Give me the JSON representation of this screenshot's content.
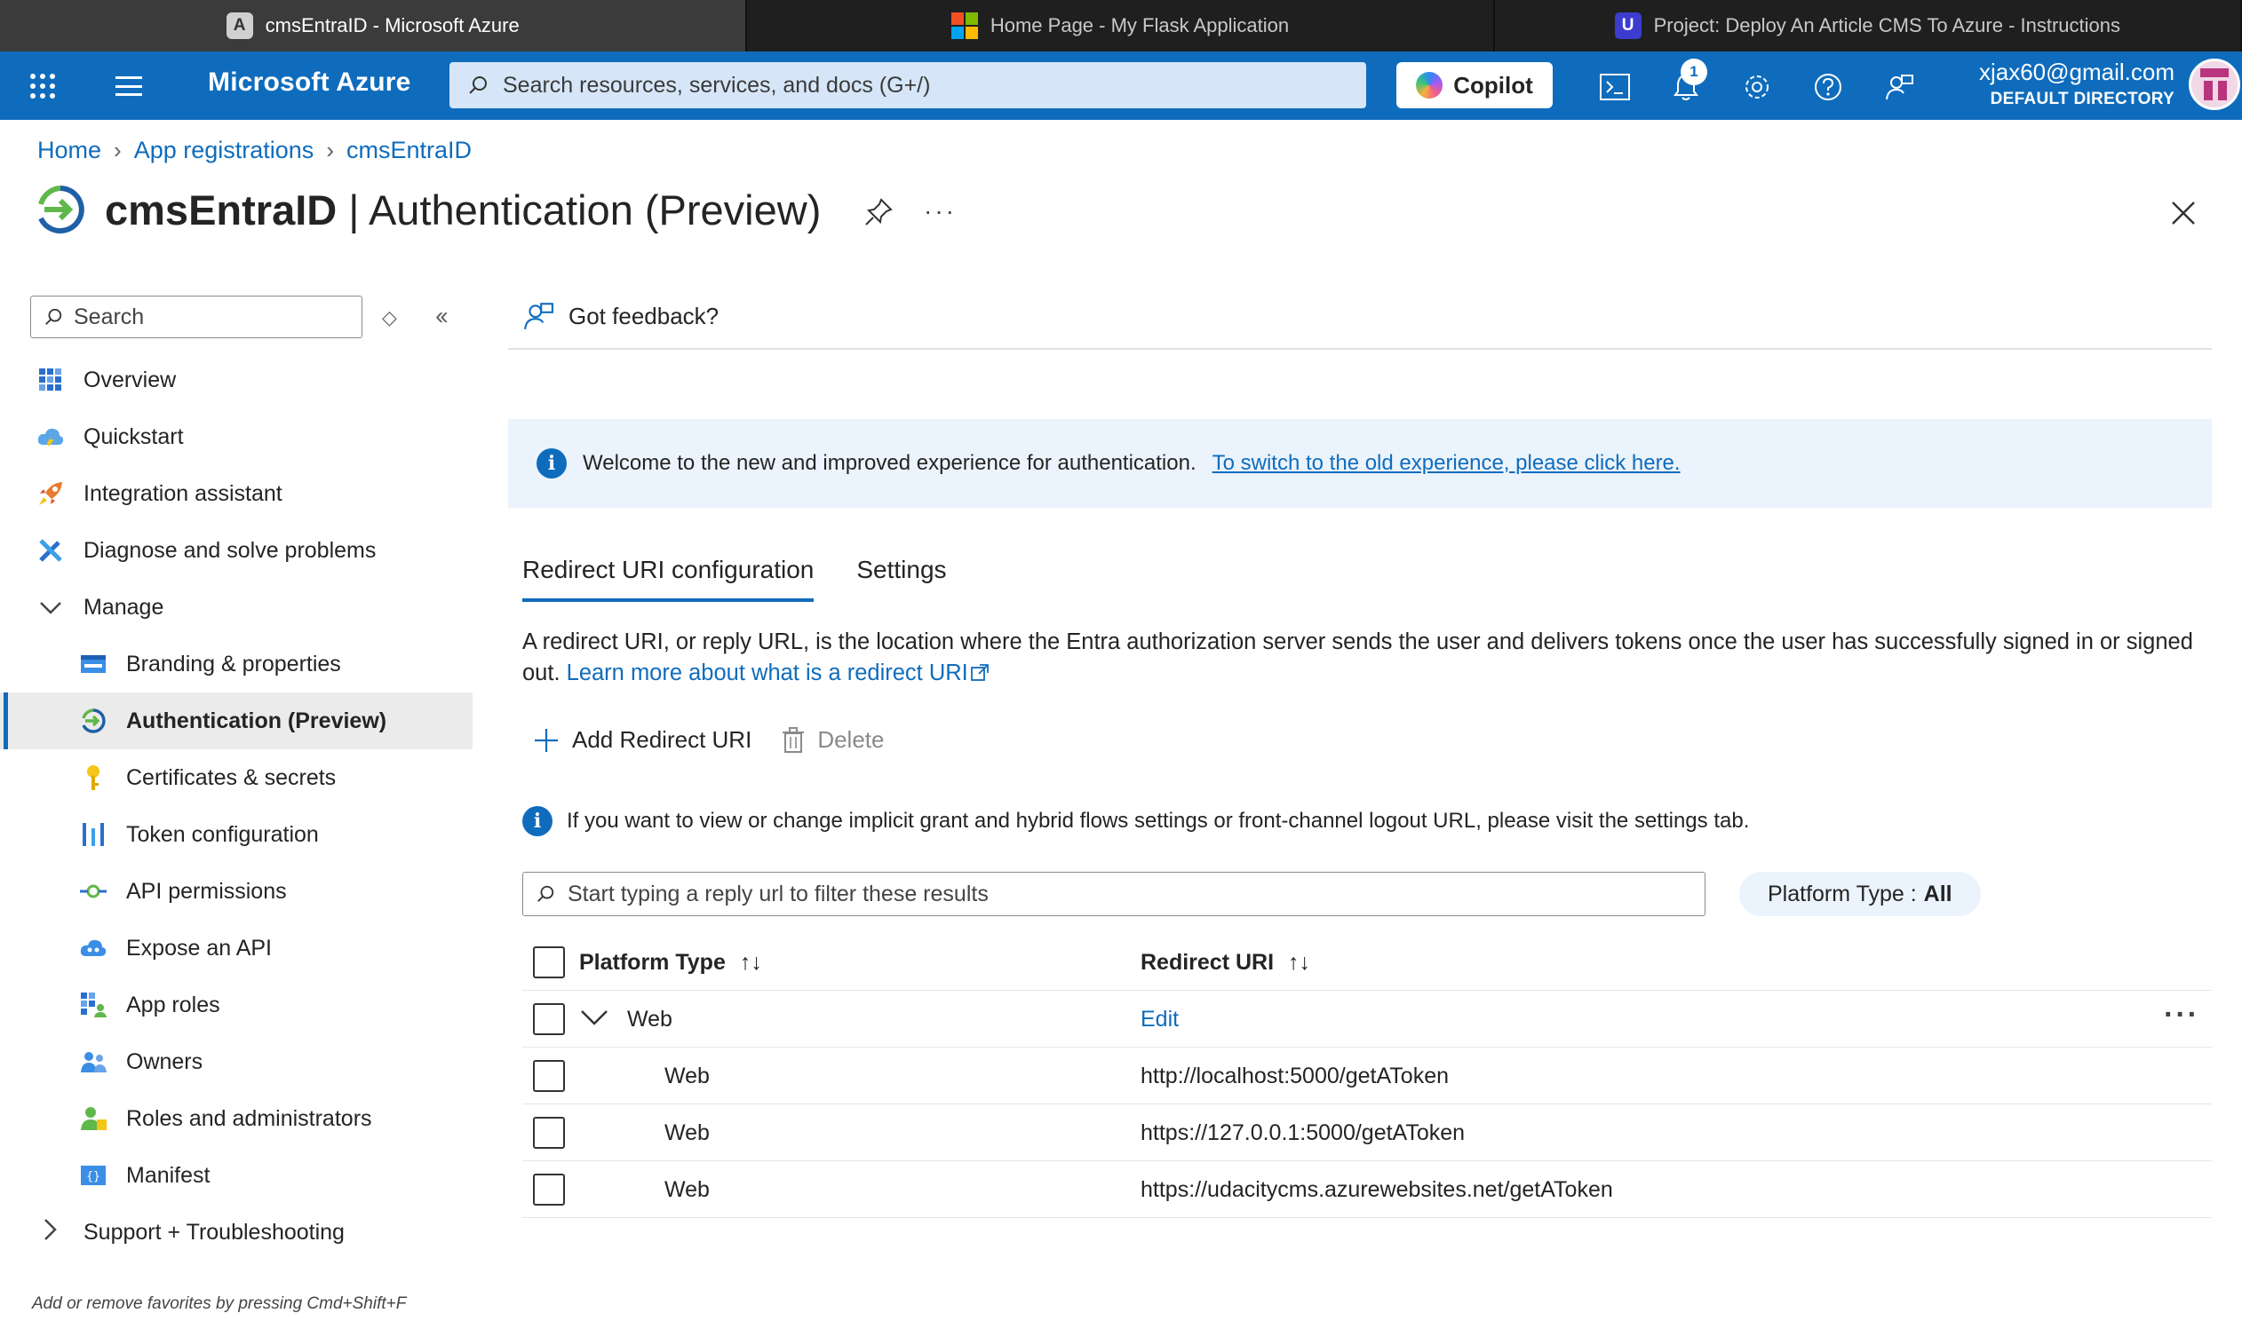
{
  "browser_tabs": [
    {
      "label": "cmsEntraID - Microsoft Azure",
      "icon": "letter-a-icon",
      "icon_text": "A",
      "active": true
    },
    {
      "label": "Home Page - My Flask Application",
      "icon": "microsoft-logo-icon",
      "active": false
    },
    {
      "label": "Project: Deploy An Article CMS To Azure - Instructions",
      "icon": "udacity-logo-icon",
      "icon_text": "U",
      "active": false
    }
  ],
  "header": {
    "brand": "Microsoft Azure",
    "search_placeholder": "Search resources, services, and docs (G+/)",
    "copilot_label": "Copilot",
    "notification_count": "1",
    "account_email": "xjax60@gmail.com",
    "account_directory": "DEFAULT DIRECTORY",
    "accent_color": "#0f6cbd"
  },
  "breadcrumb": [
    "Home",
    "App registrations",
    "cmsEntraID"
  ],
  "page": {
    "title_strong": "cmsEntraID",
    "title_rest": " | Authentication (Preview)",
    "more": "···"
  },
  "nav": {
    "search_placeholder": "Search",
    "items": [
      {
        "label": "Overview",
        "icon": "overview-grid-icon",
        "level": 0
      },
      {
        "label": "Quickstart",
        "icon": "cloud-quickstart-icon",
        "level": 0
      },
      {
        "label": "Integration assistant",
        "icon": "rocket-icon",
        "level": 0
      },
      {
        "label": "Diagnose and solve problems",
        "icon": "wrench-icon",
        "level": 0
      },
      {
        "label": "Manage",
        "icon": "chevron-down-icon",
        "level": 0,
        "group": true
      },
      {
        "label": "Branding & properties",
        "icon": "branding-icon",
        "level": 1
      },
      {
        "label": "Authentication (Preview)",
        "icon": "authentication-icon",
        "level": 1,
        "selected": true
      },
      {
        "label": "Certificates & secrets",
        "icon": "key-icon",
        "level": 1
      },
      {
        "label": "Token configuration",
        "icon": "token-bars-icon",
        "level": 1
      },
      {
        "label": "API permissions",
        "icon": "api-permissions-icon",
        "level": 1
      },
      {
        "label": "Expose an API",
        "icon": "cloud-api-icon",
        "level": 1
      },
      {
        "label": "App roles",
        "icon": "app-roles-icon",
        "level": 1
      },
      {
        "label": "Owners",
        "icon": "owners-icon",
        "level": 1
      },
      {
        "label": "Roles and administrators",
        "icon": "roles-admins-icon",
        "level": 1
      },
      {
        "label": "Manifest",
        "icon": "manifest-icon",
        "level": 1
      },
      {
        "label": "Support + Troubleshooting",
        "icon": "chevron-right-icon",
        "level": 0,
        "group": true
      }
    ],
    "footer": "Add or remove favorites by pressing Cmd+Shift+F"
  },
  "main": {
    "feedback": "Got feedback?",
    "info_text": "Welcome to the new and improved experience for authentication.",
    "info_link": "To switch to the old experience, please click here.",
    "tabs": [
      "Redirect URI configuration",
      "Settings"
    ],
    "description": "A redirect URI, or reply URL, is the location where the Entra authorization server sends the user and delivers tokens once the user has successfully signed in or signed out.",
    "learn_more": "Learn more about what is a redirect URI",
    "add_label": "Add Redirect URI",
    "delete_label": "Delete",
    "note": "If you want to view or change implicit grant and hybrid flows settings or front-channel logout URL, please visit the settings tab.",
    "filter_placeholder": "Start typing a reply url to filter these results",
    "platform_filter_label": "Platform Type :",
    "platform_filter_value": "All"
  },
  "table": {
    "columns": [
      "Platform Type",
      "Redirect URI"
    ],
    "group": {
      "platform": "Web",
      "action": "Edit",
      "more": "···"
    },
    "rows": [
      {
        "platform": "Web",
        "uri": "http://localhost:5000/getAToken"
      },
      {
        "platform": "Web",
        "uri": "https://127.0.0.1:5000/getAToken"
      },
      {
        "platform": "Web",
        "uri": "https://udacitycms.azurewebsites.net/getAToken"
      }
    ]
  }
}
